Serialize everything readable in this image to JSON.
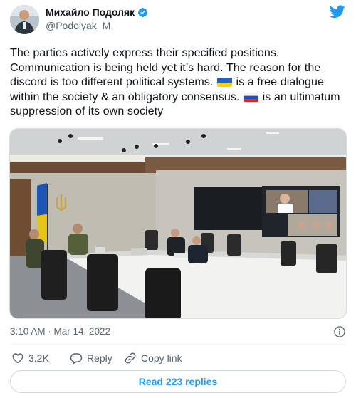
{
  "author": {
    "name": "Михайло Подоляк",
    "handle": "@Podolyak_M"
  },
  "tweet": {
    "text_part1": "The parties actively express their specified positions. Communication is being held yet it’s hard. The reason for the discord is too different political systems.",
    "text_part2": "is a free dialogue within the society & an obligatory consensus.",
    "text_part3": "is an ultimatum suppression of its own society",
    "flag1": "ukraine-flag-icon",
    "flag2": "russia-flag-icon"
  },
  "meta": {
    "timestamp": "3:10 AM · Mar 14, 2022"
  },
  "actions": {
    "likes_count": "3.2K",
    "reply_label": "Reply",
    "copy_link_label": "Copy link"
  },
  "replies_button": {
    "label": "Read 223 replies"
  },
  "colors": {
    "accent": "#1d9bf0",
    "text": "#0f1419",
    "secondary": "#536471"
  }
}
